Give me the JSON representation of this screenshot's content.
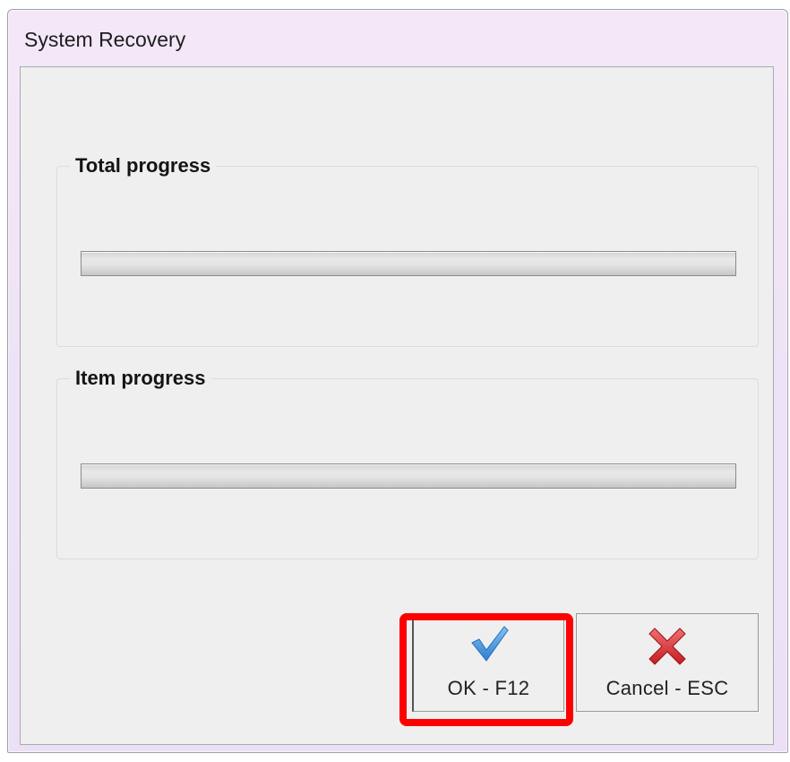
{
  "window": {
    "title": "System Recovery"
  },
  "total_progress": {
    "label": "Total progress",
    "value_percent": 0
  },
  "item_progress": {
    "label": "Item progress",
    "value_percent": 0
  },
  "buttons": {
    "ok": {
      "label": "OK - F12",
      "icon": "checkmark-icon"
    },
    "cancel": {
      "label": "Cancel - ESC",
      "icon": "close-x-icon"
    }
  },
  "colors": {
    "highlight": "#ff0000",
    "check": "#3a8fd8",
    "cancel_x": "#d8232a"
  }
}
